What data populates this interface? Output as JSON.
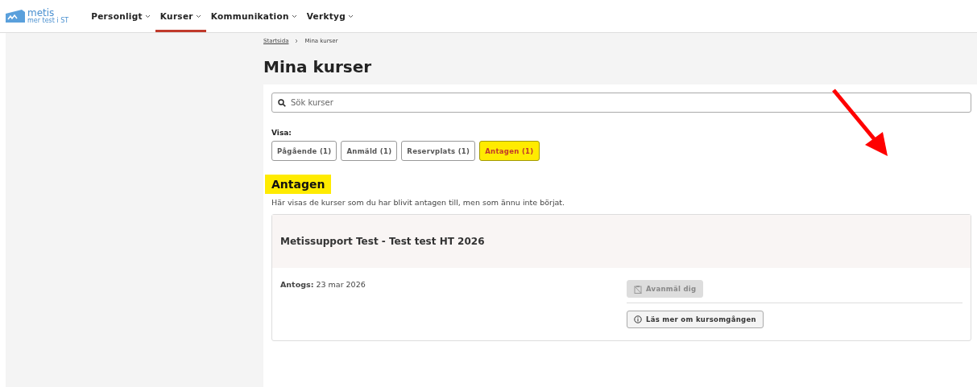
{
  "logo": {
    "name": "metis",
    "tagline": "mer test i ST"
  },
  "nav": [
    {
      "label": "Personligt",
      "selected": false
    },
    {
      "label": "Kurser",
      "selected": true
    },
    {
      "label": "Kommunikation",
      "selected": false
    },
    {
      "label": "Verktyg",
      "selected": false
    }
  ],
  "breadcrumb": [
    {
      "label": "Startsida",
      "kind": "link"
    },
    {
      "label": "Mina kurser",
      "kind": "current"
    }
  ],
  "page_title": "Mina kurser",
  "search": {
    "placeholder": "Sök kurser"
  },
  "filter_label": "Visa:",
  "filters": [
    {
      "label": "Pågående (1)",
      "selected": false
    },
    {
      "label": "Anmäld (1)",
      "selected": false
    },
    {
      "label": "Reservplats (1)",
      "selected": false
    },
    {
      "label": "Antagen (1)",
      "selected": true
    }
  ],
  "section": {
    "title": "Antagen",
    "highlighted": true,
    "description": "Här visas de kurser som du har blivit antagen till, men som ännu inte börjat."
  },
  "courses": [
    {
      "title": "Metissupport Test - Test test HT 2026",
      "admitted_label": "Antogs:",
      "admitted_date": "23 mar 2026",
      "actions": [
        {
          "label": "Avanmäl dig",
          "kind": "unregister",
          "disabled": true
        },
        {
          "label": "Läs mer om kursomgången",
          "kind": "info",
          "disabled": false
        }
      ]
    }
  ]
}
